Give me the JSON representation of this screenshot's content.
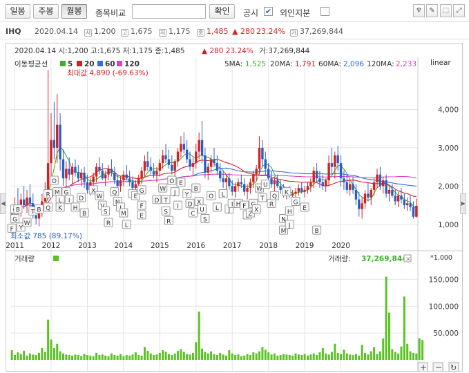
{
  "toolbar": {
    "buttons": [
      "일봉",
      "주봉",
      "월봉"
    ],
    "active_button": "월봉",
    "compare_label": "종목비교",
    "compare_input_value": "",
    "confirm_label": "확인",
    "disclosure_label": "공시",
    "disclosure_checked": true,
    "foreign_label": "외인지분",
    "foreign_checked": false,
    "right_icons": [
      "pin-icon",
      "pencil-icon",
      "cursor-icon",
      "expand-icon"
    ]
  },
  "info": {
    "ticker": "IHQ",
    "date": "2020.04.14",
    "open": "1,200",
    "high": "1,675",
    "low": "1,175",
    "close": "1,485",
    "change": "▲ 280",
    "change_pct": "23.24%",
    "volume": "37,269,844",
    "icon_open": "시",
    "icon_high": "고",
    "icon_low": "저",
    "icon_close": "종",
    "icon_volume": "거"
  },
  "chart_header": {
    "line": "2020.04.14 시:1,200 고:1,675 저:1,175 종:1,485",
    "change": "▲ 280 23.24%",
    "volume": "거:37,269,844"
  },
  "ma_legend": {
    "title": "이동평균선",
    "items": [
      {
        "label": "5",
        "color": "#3fae2a"
      },
      {
        "label": "20",
        "color": "#d42020"
      },
      {
        "label": "60",
        "color": "#2a6fd6"
      },
      {
        "label": "120",
        "color": "#e040c0"
      }
    ]
  },
  "ma_values": [
    {
      "label": "5MA:",
      "value": "1,525",
      "color": "#3fae2a"
    },
    {
      "label": "20MA:",
      "value": "1,791",
      "color": "#d42020"
    },
    {
      "label": "60MA:",
      "value": "2,096",
      "color": "#2a6fd6"
    },
    {
      "label": "120MA:",
      "value": "2,233",
      "color": "#e040c0"
    }
  ],
  "scale_label": "linear",
  "max_annotation": "최대값 4,890 (-69.63%)",
  "min_annotation": "최소값 785 (89.17%)",
  "volume_panel": {
    "title": "거래량",
    "value_label": "거래량:",
    "value": "37,269,844",
    "unit": "*1,000",
    "close_icon": "×"
  },
  "colors": {
    "up": "#d42020",
    "down": "#2a5dc8",
    "volume": "#5ac323",
    "grid": "#e4e4e4"
  },
  "chart_data": {
    "type": "candlestick",
    "price_axis": {
      "ticks": [
        1000,
        2000,
        3000,
        4000
      ],
      "tick_labels": [
        "1,000",
        "2,000",
        "3,000",
        "4,000"
      ],
      "ylim": [
        600,
        5000
      ]
    },
    "volume_axis": {
      "ticks": [
        50000,
        100000,
        150000
      ],
      "tick_labels": [
        "50,000",
        "100,000",
        "150,000"
      ],
      "ylim": [
        0,
        175000
      ],
      "unit": "*1,000"
    },
    "x_axis": {
      "labels": [
        "2011",
        "2012",
        "2013",
        "2014",
        "2015",
        "2016",
        "2017",
        "2018",
        "2019",
        "2020"
      ]
    },
    "start": "2010-12",
    "candles": [
      [
        1100,
        1480,
        900,
        1300
      ],
      [
        1300,
        1700,
        1150,
        1500
      ],
      [
        1500,
        1950,
        1250,
        1350
      ],
      [
        1350,
        1800,
        1200,
        1650
      ],
      [
        1650,
        2000,
        1400,
        1500
      ],
      [
        1500,
        1900,
        1300,
        1700
      ],
      [
        1700,
        2050,
        1450,
        1550
      ],
      [
        1550,
        1800,
        1150,
        1300
      ],
      [
        1300,
        1500,
        1000,
        1150
      ],
      [
        1150,
        1450,
        950,
        1350
      ],
      [
        1350,
        1800,
        1200,
        1600
      ],
      [
        1600,
        2100,
        1450,
        1900
      ],
      [
        1900,
        4890,
        1650,
        2600
      ],
      [
        2600,
        3900,
        2200,
        3200
      ],
      [
        3200,
        4200,
        2700,
        3000
      ],
      [
        3000,
        4400,
        2600,
        3600
      ],
      [
        3600,
        3900,
        2400,
        2700
      ],
      [
        2700,
        2950,
        2000,
        2200
      ],
      [
        2200,
        2650,
        1950,
        2450
      ],
      [
        2450,
        2750,
        2150,
        2300
      ],
      [
        2300,
        2600,
        2050,
        2500
      ],
      [
        2500,
        2700,
        2250,
        2350
      ],
      [
        2350,
        2550,
        2100,
        2200
      ],
      [
        2200,
        2450,
        2000,
        2350
      ],
      [
        2350,
        2500,
        1950,
        2100
      ],
      [
        2100,
        2300,
        1800,
        1900
      ],
      [
        1900,
        2200,
        1750,
        2100
      ],
      [
        2100,
        2350,
        1950,
        2250
      ],
      [
        2250,
        2600,
        2100,
        2500
      ],
      [
        2500,
        2750,
        2300,
        2400
      ],
      [
        2400,
        2600,
        2150,
        2200
      ],
      [
        2200,
        2400,
        2000,
        2300
      ],
      [
        2300,
        2550,
        2150,
        2450
      ],
      [
        2450,
        2700,
        2250,
        2350
      ],
      [
        2350,
        2500,
        2050,
        2150
      ],
      [
        2150,
        2300,
        1900,
        2000
      ],
      [
        2000,
        2250,
        1850,
        2150
      ],
      [
        2150,
        2400,
        2000,
        2300
      ],
      [
        2300,
        2550,
        2150,
        2200
      ],
      [
        2200,
        2400,
        2000,
        2100
      ],
      [
        2100,
        2250,
        1850,
        1950
      ],
      [
        1950,
        2150,
        1800,
        2050
      ],
      [
        2050,
        2300,
        1900,
        2200
      ],
      [
        2200,
        2500,
        2050,
        2400
      ],
      [
        2400,
        2800,
        2250,
        2650
      ],
      [
        2650,
        2900,
        2400,
        2500
      ],
      [
        2500,
        2750,
        2300,
        2400
      ],
      [
        2400,
        2600,
        2200,
        2300
      ],
      [
        2300,
        2500,
        2100,
        2400
      ],
      [
        2400,
        2700,
        2250,
        2600
      ],
      [
        2600,
        2950,
        2450,
        2800
      ],
      [
        2800,
        3100,
        2600,
        2700
      ],
      [
        2700,
        2950,
        2450,
        2550
      ],
      [
        2550,
        2800,
        2300,
        2400
      ],
      [
        2400,
        2700,
        2250,
        2650
      ],
      [
        2650,
        3000,
        2500,
        2900
      ],
      [
        2900,
        3300,
        2750,
        3100
      ],
      [
        3100,
        3400,
        2850,
        2950
      ],
      [
        2950,
        3200,
        2600,
        2700
      ],
      [
        2700,
        2900,
        2400,
        2500
      ],
      [
        2500,
        2750,
        2300,
        2600
      ],
      [
        2600,
        3100,
        2450,
        2900
      ],
      [
        2900,
        3400,
        2700,
        3200
      ],
      [
        3200,
        3700,
        2600,
        2800
      ],
      [
        2800,
        3000,
        2200,
        2350
      ],
      [
        2350,
        2600,
        2150,
        2500
      ],
      [
        2500,
        2800,
        2350,
        2700
      ],
      [
        2700,
        3000,
        2500,
        2600
      ],
      [
        2600,
        2800,
        2300,
        2400
      ],
      [
        2400,
        2600,
        2100,
        2200
      ],
      [
        2200,
        2400,
        1950,
        2100
      ],
      [
        2100,
        2300,
        1900,
        2200
      ],
      [
        2200,
        2350,
        1900,
        2000
      ],
      [
        2000,
        2150,
        1750,
        1850
      ],
      [
        1850,
        2100,
        1700,
        2000
      ],
      [
        2000,
        2200,
        1850,
        2100
      ],
      [
        2100,
        2300,
        1950,
        2050
      ],
      [
        2050,
        2200,
        1750,
        1850
      ],
      [
        1850,
        2050,
        1650,
        1950
      ],
      [
        1950,
        2200,
        1800,
        2100
      ],
      [
        2100,
        2400,
        1950,
        2300
      ],
      [
        2300,
        2550,
        2150,
        2450
      ],
      [
        2450,
        3300,
        2300,
        3000
      ],
      [
        3000,
        3200,
        2500,
        2700
      ],
      [
        2700,
        2900,
        2300,
        2450
      ],
      [
        2450,
        2600,
        2100,
        2200
      ],
      [
        2200,
        2400,
        1950,
        2050
      ],
      [
        2050,
        2250,
        1850,
        2150
      ],
      [
        2150,
        2300,
        1950,
        2000
      ],
      [
        2000,
        2150,
        1800,
        1900
      ],
      [
        1900,
        2050,
        1700,
        1800
      ],
      [
        1800,
        1950,
        1650,
        1850
      ],
      [
        1850,
        2000,
        1700,
        1750
      ],
      [
        1750,
        1900,
        1600,
        1800
      ],
      [
        1800,
        1950,
        1650,
        1850
      ],
      [
        1850,
        2050,
        1750,
        1950
      ],
      [
        1950,
        2100,
        1800,
        1850
      ],
      [
        1850,
        2000,
        1700,
        1900
      ],
      [
        1900,
        2100,
        1800,
        2000
      ],
      [
        2000,
        2200,
        1850,
        2100
      ],
      [
        2100,
        2500,
        1950,
        2400
      ],
      [
        2400,
        2600,
        2100,
        2200
      ],
      [
        2200,
        2400,
        1950,
        2100
      ],
      [
        2100,
        2300,
        1900,
        2000
      ],
      [
        2000,
        2200,
        1850,
        2150
      ],
      [
        2150,
        2800,
        2000,
        2600
      ],
      [
        2600,
        3000,
        2300,
        2500
      ],
      [
        2500,
        2900,
        2200,
        2800
      ],
      [
        2800,
        3050,
        2400,
        2600
      ],
      [
        2600,
        2800,
        2000,
        2200
      ],
      [
        2200,
        2400,
        1900,
        2100
      ],
      [
        2100,
        2300,
        1800,
        1900
      ],
      [
        1900,
        2150,
        1750,
        2050
      ],
      [
        2050,
        2250,
        1800,
        1900
      ],
      [
        1900,
        2050,
        1500,
        1650
      ],
      [
        1650,
        1850,
        1200,
        1400
      ],
      [
        1400,
        1700,
        1150,
        1550
      ],
      [
        1550,
        1900,
        1400,
        1800
      ],
      [
        1800,
        2100,
        1600,
        1700
      ],
      [
        1700,
        1950,
        1500,
        1900
      ],
      [
        1900,
        2200,
        1750,
        2100
      ],
      [
        2100,
        2450,
        1950,
        2300
      ],
      [
        2300,
        2500,
        1900,
        2000
      ],
      [
        2000,
        2250,
        1800,
        2150
      ],
      [
        2150,
        2300,
        1700,
        1800
      ],
      [
        1800,
        2000,
        1600,
        1900
      ],
      [
        1900,
        2050,
        1700,
        1750
      ],
      [
        1750,
        1900,
        1500,
        1600
      ],
      [
        1600,
        1850,
        1450,
        1750
      ],
      [
        1750,
        1950,
        1550,
        1650
      ],
      [
        1650,
        1800,
        1400,
        1500
      ],
      [
        1500,
        1700,
        1350,
        1550
      ],
      [
        1550,
        1750,
        1350,
        1450
      ],
      [
        1450,
        1600,
        1150,
        1200
      ],
      [
        1200,
        1675,
        1175,
        1485
      ]
    ],
    "volume": [
      18,
      9,
      14,
      11,
      17,
      8,
      12,
      10,
      9,
      13,
      22,
      15,
      75,
      38,
      22,
      30,
      16,
      12,
      10,
      9,
      8,
      10,
      9,
      7,
      11,
      9,
      8,
      7,
      13,
      9,
      10,
      8,
      7,
      12,
      9,
      8,
      11,
      7,
      9,
      8,
      10,
      14,
      9,
      8,
      24,
      17,
      12,
      9,
      10,
      13,
      18,
      15,
      11,
      9,
      12,
      17,
      20,
      15,
      11,
      10,
      13,
      33,
      90,
      21,
      15,
      12,
      16,
      11,
      9,
      13,
      10,
      8,
      18,
      12,
      9,
      10,
      7,
      8,
      11,
      9,
      14,
      12,
      16,
      24,
      19,
      14,
      10,
      12,
      8,
      9,
      11,
      10,
      9,
      8,
      12,
      10,
      9,
      11,
      8,
      10,
      12,
      9,
      14,
      22,
      12,
      10,
      15,
      30,
      13,
      11,
      19,
      12,
      10,
      9,
      11,
      8,
      28,
      13,
      10,
      16,
      24,
      11,
      16,
      40,
      155,
      88,
      20,
      15,
      12,
      25,
      118,
      30,
      16,
      13,
      12,
      40,
      37
    ],
    "series": [
      {
        "name": "5"
      },
      {
        "name": "20"
      },
      {
        "name": "60"
      },
      {
        "name": "120"
      }
    ]
  },
  "event_labels": [
    {
      "t": 1,
      "y": 1400,
      "text": "C"
    },
    {
      "t": 2,
      "y": 1400,
      "text": "B"
    },
    {
      "t": 1,
      "y": 1150,
      "text": "G"
    },
    {
      "t": 0,
      "y": 900,
      "text": "F"
    },
    {
      "t": 3,
      "y": 930,
      "text": "Y"
    },
    {
      "t": 5,
      "y": 1050,
      "text": "W"
    },
    {
      "t": 7,
      "y": 1350,
      "text": "T"
    },
    {
      "t": 9,
      "y": 1400,
      "text": "B"
    },
    {
      "t": 12,
      "y": 1800,
      "text": "R"
    },
    {
      "t": 12,
      "y": 1450,
      "text": "Q"
    },
    {
      "t": 14,
      "y": 2150,
      "text": "O"
    },
    {
      "t": 15,
      "y": 1850,
      "text": "M"
    },
    {
      "t": 16,
      "y": 1650,
      "text": "L"
    },
    {
      "t": 16,
      "y": 1450,
      "text": "K"
    },
    {
      "t": 18,
      "y": 1850,
      "text": "G"
    },
    {
      "t": 19,
      "y": 1650,
      "text": "I"
    },
    {
      "t": 21,
      "y": 1450,
      "text": "H"
    },
    {
      "t": 23,
      "y": 1700,
      "text": "D"
    },
    {
      "t": 24,
      "y": 1300,
      "text": "B"
    },
    {
      "t": 27,
      "y": 1900,
      "text": "X"
    },
    {
      "t": 29,
      "y": 1750,
      "text": "W"
    },
    {
      "t": 30,
      "y": 1500,
      "text": "V"
    },
    {
      "t": 31,
      "y": 1350,
      "text": "S"
    },
    {
      "t": 32,
      "y": 1050,
      "text": "R"
    },
    {
      "t": 34,
      "y": 1850,
      "text": "Q"
    },
    {
      "t": 35,
      "y": 1600,
      "text": "N"
    },
    {
      "t": 36,
      "y": 1450,
      "text": "J"
    },
    {
      "t": 37,
      "y": 1300,
      "text": "M"
    },
    {
      "t": 38,
      "y": 1000,
      "text": "L"
    },
    {
      "t": 40,
      "y": 1800,
      "text": "I"
    },
    {
      "t": 41,
      "y": 1750,
      "text": "E"
    },
    {
      "t": 43,
      "y": 1900,
      "text": "G"
    },
    {
      "t": 43,
      "y": 1500,
      "text": "F"
    },
    {
      "t": 43,
      "y": 1250,
      "text": "E"
    },
    {
      "t": 48,
      "y": 1650,
      "text": "D"
    },
    {
      "t": 50,
      "y": 1950,
      "text": "W"
    },
    {
      "t": 51,
      "y": 1650,
      "text": "T"
    },
    {
      "t": 51,
      "y": 1350,
      "text": "S"
    },
    {
      "t": 52,
      "y": 1100,
      "text": "R"
    },
    {
      "t": 53,
      "y": 2150,
      "text": "O"
    },
    {
      "t": 54,
      "y": 1850,
      "text": "J"
    },
    {
      "t": 55,
      "y": 1500,
      "text": "I"
    },
    {
      "t": 56,
      "y": 2100,
      "text": "E"
    },
    {
      "t": 58,
      "y": 1800,
      "text": "Y"
    },
    {
      "t": 59,
      "y": 1550,
      "text": "D"
    },
    {
      "t": 60,
      "y": 1300,
      "text": "C"
    },
    {
      "t": 61,
      "y": 1950,
      "text": "B"
    },
    {
      "t": 62,
      "y": 1600,
      "text": "X"
    },
    {
      "t": 63,
      "y": 1400,
      "text": "U"
    },
    {
      "t": 64,
      "y": 1150,
      "text": "S"
    },
    {
      "t": 66,
      "y": 1750,
      "text": "O"
    },
    {
      "t": 68,
      "y": 1450,
      "text": "L"
    },
    {
      "t": 70,
      "y": 1800,
      "text": "L"
    },
    {
      "t": 72,
      "y": 1400,
      "text": "J"
    },
    {
      "t": 73,
      "y": 1550,
      "text": "I"
    },
    {
      "t": 75,
      "y": 1550,
      "text": "H"
    },
    {
      "t": 77,
      "y": 1500,
      "text": "F"
    },
    {
      "t": 78,
      "y": 1250,
      "text": "E"
    },
    {
      "t": 79,
      "y": 1300,
      "text": "Z"
    },
    {
      "t": 80,
      "y": 1550,
      "text": "G"
    },
    {
      "t": 81,
      "y": 1400,
      "text": "X"
    },
    {
      "t": 82,
      "y": 1950,
      "text": "W"
    },
    {
      "t": 83,
      "y": 1700,
      "text": "T"
    },
    {
      "t": 84,
      "y": 2050,
      "text": "U"
    },
    {
      "t": 86,
      "y": 1550,
      "text": "R"
    },
    {
      "t": 87,
      "y": 1750,
      "text": "Q"
    },
    {
      "t": 90,
      "y": 1150,
      "text": "N"
    },
    {
      "t": 90,
      "y": 850,
      "text": "M"
    },
    {
      "t": 92,
      "y": 1350,
      "text": "H"
    },
    {
      "t": 92,
      "y": 1000,
      "text": "J"
    },
    {
      "t": 94,
      "y": 1600,
      "text": "G"
    },
    {
      "t": 97,
      "y": 1450,
      "text": "E"
    },
    {
      "t": 101,
      "y": 850,
      "text": "B"
    },
    {
      "t": 91,
      "y": 1850,
      "text": "K"
    }
  ]
}
